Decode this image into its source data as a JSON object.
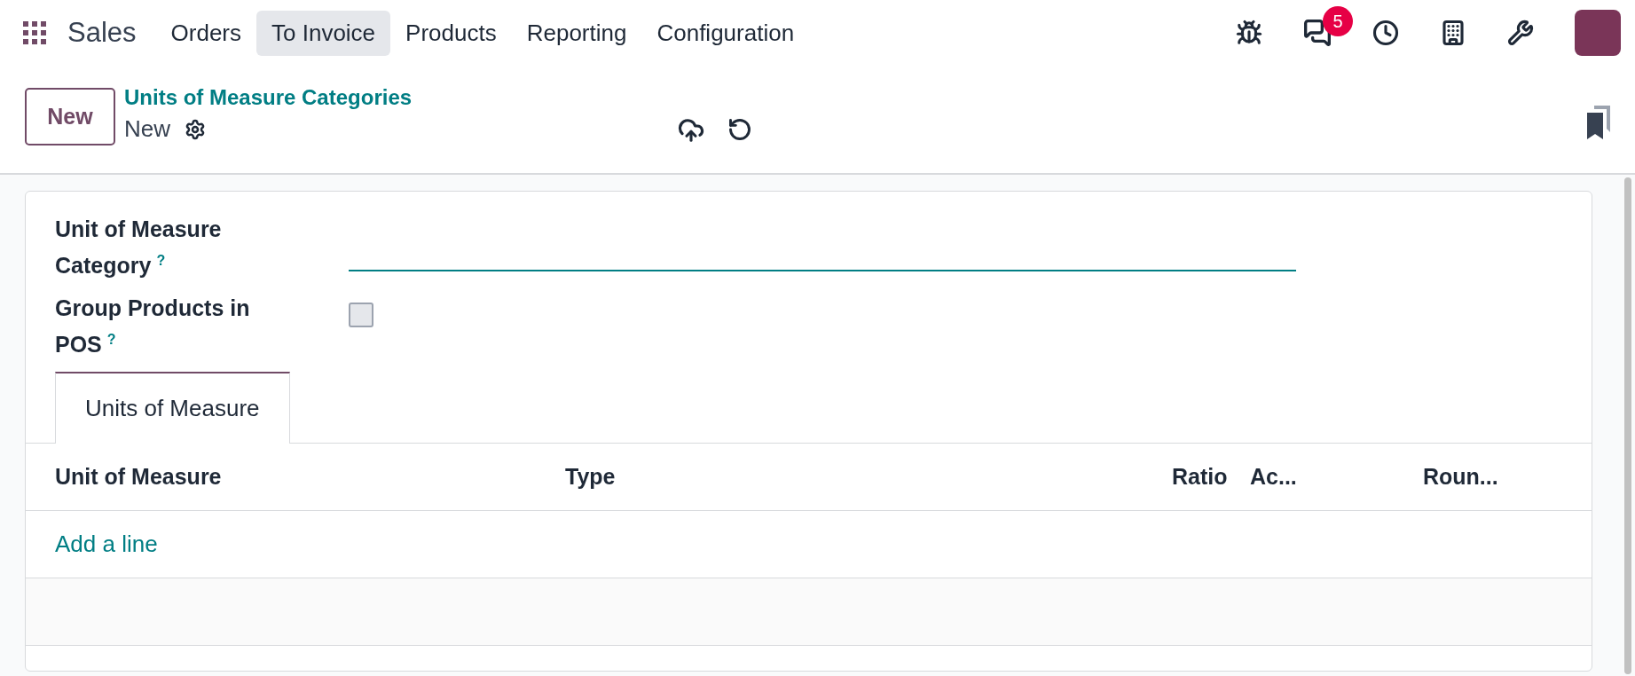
{
  "navbar": {
    "app_name": "Sales",
    "menu": [
      {
        "label": "Orders",
        "selected": false
      },
      {
        "label": "To Invoice",
        "selected": true
      },
      {
        "label": "Products",
        "selected": false
      },
      {
        "label": "Reporting",
        "selected": false
      },
      {
        "label": "Configuration",
        "selected": false
      }
    ],
    "message_count": "5"
  },
  "control_panel": {
    "new_button": "New",
    "breadcrumb": "Units of Measure Categories",
    "record_name": "New"
  },
  "form": {
    "fields": [
      {
        "kind": "text",
        "label": "Unit of Measure Category",
        "help": "?"
      },
      {
        "kind": "checkbox",
        "label": "Group Products in POS",
        "help": "?",
        "checked": false
      }
    ],
    "tabs": [
      {
        "label": "Units of Measure",
        "selected": true
      }
    ],
    "table": {
      "columns": [
        "Unit of Measure",
        "Type",
        "Ratio",
        "Ac...",
        "Roun..."
      ],
      "add_line": "Add a line"
    }
  }
}
